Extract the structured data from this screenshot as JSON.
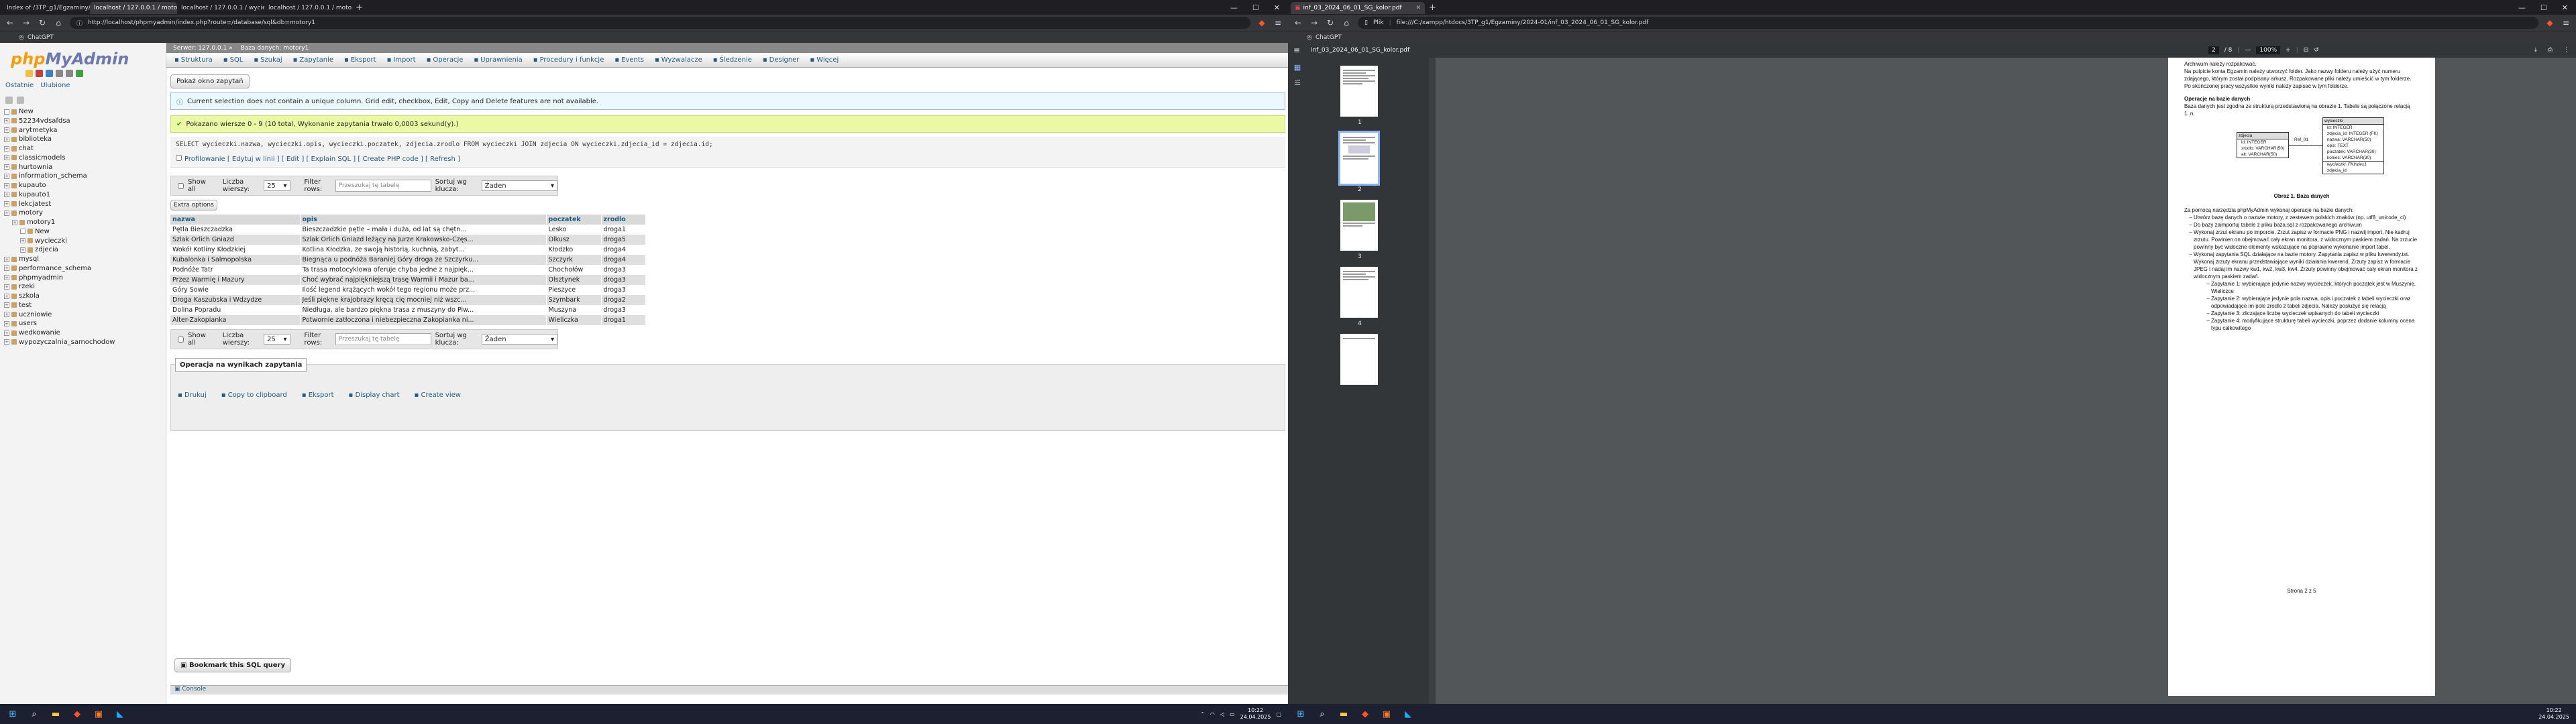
{
  "left_browser": {
    "tabs": [
      "Index of /3TP_g1/Egzaminy/2024-0",
      "localhost / 127.0.0.1 / motory1",
      "localhost / 127.0.0.1 / wycieczki",
      "localhost / 127.0.0.1 / motory1 / zdjecia"
    ],
    "url": "http://localhost/phpmyadmin/index.php?route=/database/sql&db=motory1",
    "bookmark": "ChatGPT"
  },
  "pma": {
    "logo_a": "php",
    "logo_b": "MyAdmin",
    "nav_tabs": [
      "Ostatnie",
      "Ulubione"
    ],
    "databases": [
      "New",
      "52234vdsafdsa",
      "arytmetyka",
      "biblioteka",
      "chat",
      "classicmodels",
      "hurtownia",
      "information_schema",
      "kupauto",
      "kupauto1",
      "lekcjatest",
      "motory",
      "motory1",
      "New",
      "wycieczki",
      "zdjecia",
      "mysql",
      "performance_schema",
      "phpmyadmin",
      "rzeki",
      "szkola",
      "test",
      "uczniowie",
      "users",
      "wedkowanie",
      "wypozyczalnia_samochodow"
    ],
    "breadcrumb": {
      "server": "Serwer: 127.0.0.1 »",
      "db": "Baza danych: motory1"
    },
    "menu": [
      "Struktura",
      "SQL",
      "Szukaj",
      "Zapytanie",
      "Eksport",
      "Import",
      "Operacje",
      "Uprawnienia",
      "Procedury i funkcje",
      "Events",
      "Wyzwalacze",
      "Śledzenie",
      "Designer",
      "Więcej"
    ],
    "show_query_btn": "Pokaż okno zapytań",
    "notice": "Current selection does not contain a unique column. Grid edit, checkbox, Edit, Copy and Delete features are not available.",
    "success": "Pokazano wiersze 0 - 9 (10 total, Wykonanie zapytania trwało 0,0003 sekund(y).)",
    "sql": "SELECT wycieczki.nazwa, wycieczki.opis, wycieczki.poczatek, zdjecia.zrodlo FROM wycieczki JOIN zdjecia ON wycieczki.zdjecia_id = zdjecia.id;",
    "sql_opts": "Profilowanie [ Edytuj w linii ] [ Edit ] [ Explain SQL ] [ Create PHP code ] [ Refresh ]",
    "show_all": "Show all",
    "rows_label": "Liczba wierszy:",
    "rows_value": "25",
    "filter_label": "Filter rows:",
    "filter_placeholder": "Przeszukaj tę tabelę",
    "sort_label": "Sortuj wg klucza:",
    "sort_value": "Żaden",
    "extra_options": "Extra options",
    "columns": [
      "nazwa",
      "opis",
      "poczatek",
      "zrodlo"
    ],
    "rows": [
      [
        "Pętla Bieszczadzka",
        "Bieszczadzkie pętle – mała i duża, od lat są chętn...",
        "Lesko",
        "droga1"
      ],
      [
        "Szlak Orlich Gniazd",
        "Szlak Orlich Gniazd leżący na Jurze Krakowsko-Częs...",
        "Olkusz",
        "droga5"
      ],
      [
        "Wokół Kotliny Kłodzkiej",
        "Kotlina Kłodzka, ze swoją historią, kuchnią, zabyt...",
        "Kłodzko",
        "droga4"
      ],
      [
        "Kubalonka i Salmopolska",
        "Biegnąca u podnóża Baraniej Góry droga ze Szczyrku...",
        "Szczyrk",
        "droga4"
      ],
      [
        "Podnóże Tatr",
        "Ta trasa motocyklowa oferuje chyba jedne z najpięk...",
        "Chochołów",
        "droga3"
      ],
      [
        "Przez Warmię i Mazury",
        "Choć wybrać najpiękniejszą trasę Warmii i Mazur ba...",
        "Olsztynek",
        "droga3"
      ],
      [
        "Góry Sowie",
        "Ilość legend krążących wokół tego regionu może prz...",
        "Pieszyce",
        "droga3"
      ],
      [
        "Droga Kaszubska i Wdzydze",
        "Jeśli piękne krajobrazy kręcą cię mocniej niż wszc...",
        "Szymbark",
        "droga2"
      ],
      [
        "Dolina Popradu",
        "Niedługa, ale bardzo piękna trasa z muszyny do Piw...",
        "Muszyna",
        "droga3"
      ],
      [
        "Alter-Zakopianka",
        "Potwornie zatłoczona i niebezpieczna Zakopianka ni...",
        "Wieliczka",
        "droga1"
      ]
    ],
    "ops_title": "Operacja na wynikach zapytania",
    "ops": [
      "Drukuj",
      "Copy to clipboard",
      "Eksport",
      "Display chart",
      "Create view"
    ],
    "bookmark_btn": "Bookmark this SQL query",
    "console": "Console"
  },
  "right_browser": {
    "tab": "inf_03_2024_06_01_SG_kolor.pdf",
    "url_prefix": "Plik",
    "url": "file:///C:/xampp/htdocs/3TP_g1/Egzaminy/2024-01/inf_03_2024_06_01_SG_kolor.pdf",
    "bookmark": "ChatGPT"
  },
  "pdf": {
    "title": "inf_03_2024_06_01_SG_kolor.pdf",
    "page": "2",
    "pages": "/ 8",
    "zoom": "100%",
    "thumb_nums": [
      "1",
      "2",
      "3",
      "4"
    ],
    "p1": "Archiwum należy rozpakować.",
    "p2": "Na pulpicie konta Egzamin należy utworzyć folder. Jako nazwy folderu należy użyć numeru zdającego, którym został podpisany arkusz. Rozpakowane pliki należy umieścić w tym folderze. Po skończonej pracy wszystkie wyniki należy zapisać w tym folderze.",
    "h1": "Operacje na bazie danych",
    "p3": "Baza danych jest zgodna ze strukturą przedstawioną na obrazie 1. Tabele są połączone relacją 1..n.",
    "zdjecia": [
      "zdjecia",
      "id: INTEGER",
      "zrodlo: VARCHAR(50)",
      "alt: VARCHAR(50)"
    ],
    "rel": "Ref_01",
    "wycieczki": [
      "wycieczki",
      "id: INTEGER",
      "zdjecia_id: INTEGER (FK)",
      "nazwa: VARCHAR(50)",
      "opis: TEXT",
      "poczatek: VARCHAR(30)",
      "koniec: VARCHAR(30)",
      "wycieczki_FKIndex1",
      "zdjecia_id"
    ],
    "caption": "Obraz 1. Baza danych",
    "p4": "Za pomocą narzędzia phpMyAdmin wykonaj operacje na bazie danych:",
    "bullets": [
      "Utwórz bazę danych o nazwie motory, z zestawem polskich znaków (np. utf8_unicode_ci)",
      "Do bazy zaimportuj tabele z pliku baza.sql z rozpakowanego archiwum",
      "Wykonaj zrzut ekranu po imporcie. Zrzut zapisz w formacie PNG i nazwij import. Nie kadruj zrzutu. Powinien on obejmować cały ekran monitora, z widocznym paskiem zadań. Na zrzucie powinny być widoczne elementy wskazujące na poprawne wykonanie import tabel.",
      "Wykonaj zapytania SQL działające na bazie motory. Zapytania zapisz w pliku kwerendy.txt. Wykonaj zrzuty ekranu przedstawiające wyniki działania kwerend. Zrzuty zapisz w formacie JPEG i nadaj im nazwy kw1, kw2, kw3, kw4. Zrzuty powinny obejmować cały ekran monitora z widocznym paskiem zadań."
    ],
    "sub": [
      "Zapytanie 1: wybierające jedynie nazwy wycieczek, których początek jest w Muszynie, Wieliczce",
      "Zapytanie 2: wybierające jedynie pola nazwa, opis i poczatek z tabeli wycieczki oraz odpowiadające im pole zrodlo z tabeli zdjecia. Należy posłużyć się relacją",
      "Zapytanie 3: zliczające liczbę wycieczek wpisanych do tabeli wycieczki",
      "Zapytanie 4: modyfikujące strukturę tabeli wycieczki, poprzez dodanie kolumny ocena typu całkowitego"
    ],
    "footer": "Strona 2 z 5"
  },
  "taskbar": {
    "time": "10:22",
    "date": "24.04.2025"
  },
  "colors": {
    "pma_link": "#235a81",
    "success_bg": "#ebf8a4",
    "notice_bg": "#ebf8fd",
    "pdf_bg": "#525659"
  }
}
